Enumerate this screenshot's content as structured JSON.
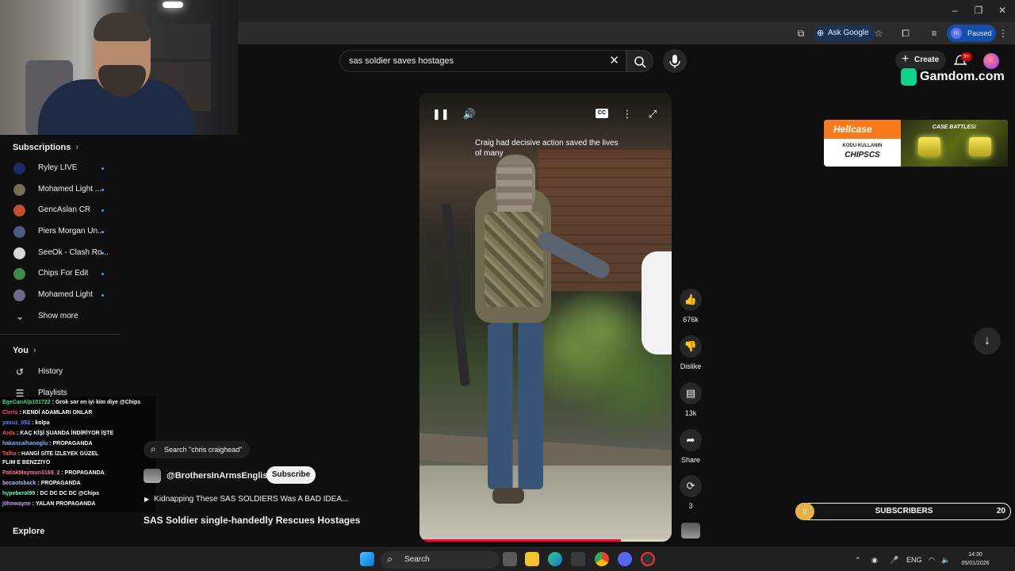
{
  "browser": {
    "window_controls": [
      "–",
      "❐",
      "✕"
    ],
    "ask_google": "Ask Google",
    "profile_initial": "m",
    "profile_status": "Paused"
  },
  "header": {
    "search_value": "sas soldier saves hostages",
    "create_label": "Create",
    "notif_badge": "9+"
  },
  "sidebar": {
    "subscriptions_header": "Subscriptions",
    "subscriptions": [
      {
        "label": "Ryley LIVE",
        "color": "#1e2a66"
      },
      {
        "label": "Mohamed Light ...",
        "color": "#7a6a58"
      },
      {
        "label": "GencAslan CR",
        "color": "#c0512a"
      },
      {
        "label": "Piers Morgan Un...",
        "color": "#4b5a80"
      },
      {
        "label": "SeeOk - Clash Ro...",
        "color": "#d8d8d8"
      },
      {
        "label": "Chips For Edit",
        "color": "#3e8a4a"
      },
      {
        "label": "Mohamed Light",
        "color": "#6d6a86"
      }
    ],
    "show_more": "Show more",
    "you_header": "You",
    "you_items": [
      {
        "label": "History",
        "icon": "history-icon"
      },
      {
        "label": "Playlists",
        "icon": "playlists-icon"
      }
    ],
    "explore": "Explore"
  },
  "chat": [
    {
      "user": "EgeCanAlp101722",
      "msg": ": Grok sor en iyi kim diye @Chips",
      "color": "#3ddc84"
    },
    {
      "user": "Cleris",
      "msg": ": KENDİ ADAMLARI ONLAR",
      "color": "#ff4d6d"
    },
    {
      "user": "yavuz_052",
      "msg": ": kolpa",
      "color": "#4d8bff"
    },
    {
      "user": "Arda",
      "msg": ": KAÇ KİŞİ ŞUANDA İNDİRİYOR İŞTE",
      "color": "#ff4d4d"
    },
    {
      "user": "hakancalhanoglu",
      "msg": ": PROPAGANDA",
      "color": "#7ab8ff"
    },
    {
      "user": "Talha",
      "msg": ": HANGİ SİTE İZLEYEK GÜZEL",
      "color": "#ff4d4d"
    },
    {
      "user": "FLIM E BENZZIYO",
      "msg": "",
      "color": "#ffffff"
    },
    {
      "user": "PatlakMaymun3169_2",
      "msg": ": PROPAGANDA",
      "color": "#ff6b9a"
    },
    {
      "user": "becaotsback",
      "msg": ": PROPAGANDA",
      "color": "#b6b6ff"
    },
    {
      "user": "hypeberat99",
      "msg": ": DC DC DC DC @Chips",
      "color": "#5cffb0"
    },
    {
      "user": "j0hnwayne",
      "msg": ": YALAN PROPAGANDA",
      "color": "#c99bff"
    }
  ],
  "video": {
    "caption": "Craig had decisive action saved the lives of many",
    "cc_label": "CC",
    "progress": 0.8,
    "likes": "676k",
    "dislike_label": "Dislike",
    "comments": "13k",
    "share_label": "Share",
    "remix_count": "3",
    "search_chip": "Search \"chris craighead\"",
    "channel": "@BrothersInArmsEnglish",
    "subscribe_label": "Subscribe",
    "related": "Kidnapping These SAS SOLDIERS Was A BAD IDEA...",
    "title": "SAS Soldier single-handedly Rescues Hostages"
  },
  "ads": {
    "gamdom": "Gamdom.com",
    "hellcase_brand": "Hellcase",
    "hellcase_line1": "KODU KULLANIN",
    "hellcase_code": "CHIPSCS",
    "hellcase_right": "CASE BATTLES!"
  },
  "subscriber_goal": {
    "current": "0",
    "label": "SUBSCRIBERS",
    "goal": "20",
    "accent": "#e6b04a"
  },
  "taskbar": {
    "search_label": "Search",
    "lang": "ENG",
    "time": "14:30",
    "date": "05/01/2026"
  }
}
